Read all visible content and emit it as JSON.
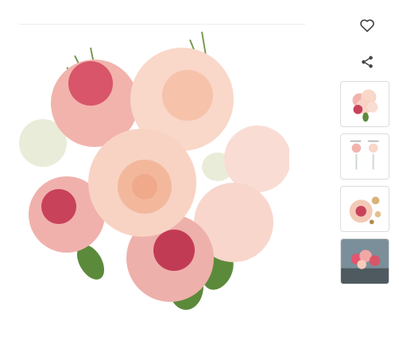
{
  "product_gallery": {
    "main_image_alt": "",
    "thumbnails": [
      {
        "name": "bouquet"
      },
      {
        "name": "size-comparison"
      },
      {
        "name": "flower-detail"
      },
      {
        "name": "lifestyle-scene"
      }
    ]
  },
  "actions": {
    "favorite_icon": "heart-outline-icon",
    "share_icon": "share-icon"
  },
  "colors": {
    "peach": "#f6cbb8",
    "pink": "#f2a7a6",
    "magenta": "#c8425a",
    "leaf": "#5c8a3b",
    "icon": "#444444",
    "border": "#dcdcdc"
  }
}
